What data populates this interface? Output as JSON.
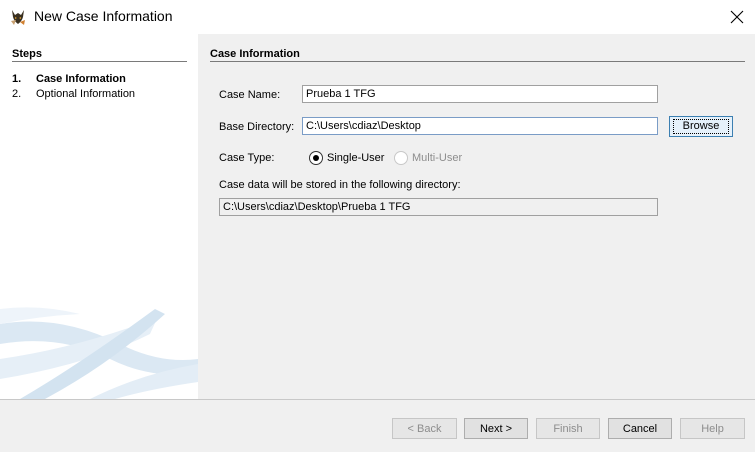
{
  "window": {
    "title": "New Case Information"
  },
  "steps": {
    "heading": "Steps",
    "items": [
      {
        "num": "1.",
        "label": "Case Information"
      },
      {
        "num": "2.",
        "label": "Optional Information"
      }
    ]
  },
  "form": {
    "heading": "Case Information",
    "case_name_label": "Case Name:",
    "case_name_value": "Prueba 1 TFG",
    "base_dir_label": "Base Directory:",
    "base_dir_value": "C:\\Users\\cdiaz\\Desktop",
    "browse_label": "Browse",
    "case_type_label": "Case Type:",
    "single_user_label": "Single-User",
    "multi_user_label": "Multi-User",
    "selected_case_type": "Single-User",
    "storage_note": "Case data will be stored in the following directory:",
    "storage_path": "C:\\Users\\cdiaz\\Desktop\\Prueba 1 TFG"
  },
  "buttons": {
    "back": "< Back",
    "next": "Next >",
    "finish": "Finish",
    "cancel": "Cancel",
    "help": "Help"
  }
}
